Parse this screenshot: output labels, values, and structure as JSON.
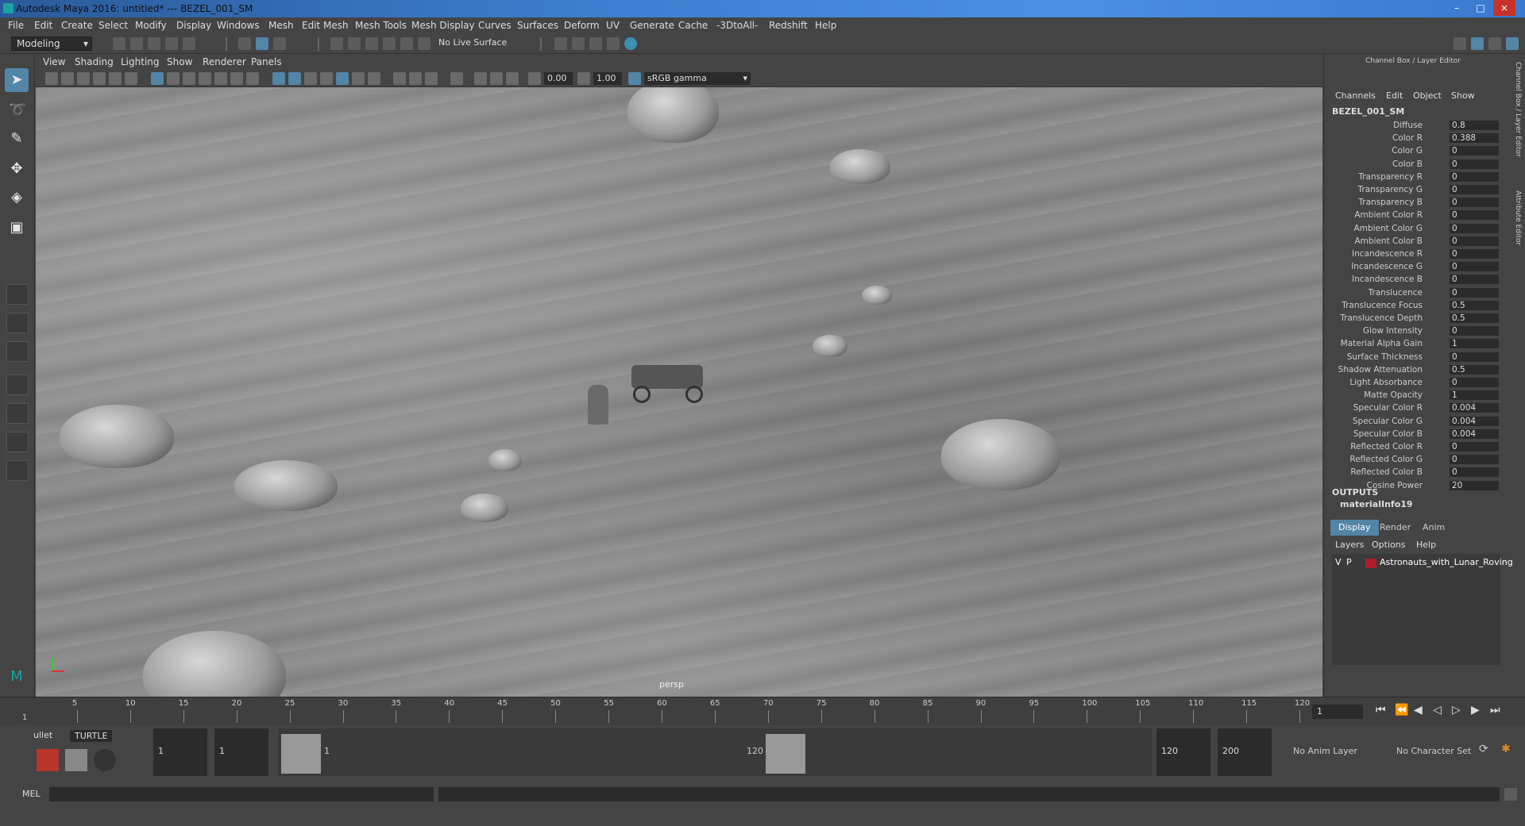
{
  "window": {
    "title": "Autodesk Maya 2016: untitled*   ---   BEZEL_001_SM",
    "controls": [
      "–",
      "□",
      "×"
    ]
  },
  "menubar": [
    "File",
    "Edit",
    "Create",
    "Select",
    "Modify",
    "Display",
    "Windows",
    "Mesh",
    "Edit Mesh",
    "Mesh Tools",
    "Mesh Display",
    "Curves",
    "Surfaces",
    "Deform",
    "UV",
    "Generate",
    "Cache",
    "-3DtoAll-",
    "Redshift",
    "Help"
  ],
  "statusline": {
    "mode": "Modeling",
    "live_surface": "No Live Surface"
  },
  "viewport": {
    "menus": [
      "View",
      "Shading",
      "Lighting",
      "Show",
      "Renderer",
      "Panels"
    ],
    "exposure": "0.00",
    "gamma": "1.00",
    "color_space": "sRGB gamma",
    "camera_label": "persp"
  },
  "channel_box": {
    "panel_title": "Channel Box / Layer Editor",
    "tabs": [
      "Channels",
      "Edit",
      "Object",
      "Show"
    ],
    "node": "BEZEL_001_SM",
    "attributes": [
      {
        "label": "Diffuse",
        "value": "0.8"
      },
      {
        "label": "Color R",
        "value": "0.388"
      },
      {
        "label": "Color G",
        "value": "0"
      },
      {
        "label": "Color B",
        "value": "0"
      },
      {
        "label": "Transparency R",
        "value": "0"
      },
      {
        "label": "Transparency G",
        "value": "0"
      },
      {
        "label": "Transparency B",
        "value": "0"
      },
      {
        "label": "Ambient Color R",
        "value": "0"
      },
      {
        "label": "Ambient Color G",
        "value": "0"
      },
      {
        "label": "Ambient Color B",
        "value": "0"
      },
      {
        "label": "Incandescence R",
        "value": "0"
      },
      {
        "label": "Incandescence G",
        "value": "0"
      },
      {
        "label": "Incandescence B",
        "value": "0"
      },
      {
        "label": "Translucence",
        "value": "0"
      },
      {
        "label": "Translucence Focus",
        "value": "0.5"
      },
      {
        "label": "Translucence Depth",
        "value": "0.5"
      },
      {
        "label": "Glow Intensity",
        "value": "0"
      },
      {
        "label": "Material Alpha Gain",
        "value": "1"
      },
      {
        "label": "Surface Thickness",
        "value": "0"
      },
      {
        "label": "Shadow Attenuation",
        "value": "0.5"
      },
      {
        "label": "Light Absorbance",
        "value": "0"
      },
      {
        "label": "Matte Opacity",
        "value": "1"
      },
      {
        "label": "Specular Color R",
        "value": "0.004"
      },
      {
        "label": "Specular Color G",
        "value": "0.004"
      },
      {
        "label": "Specular Color B",
        "value": "0.004"
      },
      {
        "label": "Reflected Color R",
        "value": "0"
      },
      {
        "label": "Reflected Color G",
        "value": "0"
      },
      {
        "label": "Reflected Color B",
        "value": "0"
      },
      {
        "label": "Cosine Power",
        "value": "20"
      }
    ],
    "outputs_label": "OUTPUTS",
    "output_node": "materialInfo19",
    "side_tabs": [
      "Channel Box / Layer Editor",
      "Attribute Editor"
    ]
  },
  "layer_editor": {
    "tabs": [
      "Display",
      "Render",
      "Anim"
    ],
    "menus": [
      "Layers",
      "Options",
      "Help"
    ],
    "layers": [
      {
        "v": "V",
        "p": "P",
        "name": "Astronauts_with_Lunar_Roving",
        "color": "#b01c2a"
      }
    ]
  },
  "timeslider": {
    "ticks": [
      "5",
      "10",
      "15",
      "20",
      "25",
      "30",
      "35",
      "40",
      "45",
      "50",
      "55",
      "60",
      "65",
      "70",
      "75",
      "80",
      "85",
      "90",
      "95",
      "100",
      "105",
      "110",
      "115",
      "120"
    ],
    "start_marker": "1",
    "current_frame": "1"
  },
  "range": {
    "shelf_tabs": [
      "ullet",
      "TURTLE"
    ],
    "anim_start": "1",
    "playback_start": "1",
    "range_start_label": "1",
    "range_end_label": "120",
    "playback_end": "120",
    "anim_end": "200",
    "anim_layer": "No Anim Layer",
    "character_set": "No Character Set"
  },
  "cmdline": {
    "label": "MEL"
  },
  "colors": {
    "accent": "#5285a6",
    "bg": "#444444",
    "field": "#2b2b2b"
  }
}
